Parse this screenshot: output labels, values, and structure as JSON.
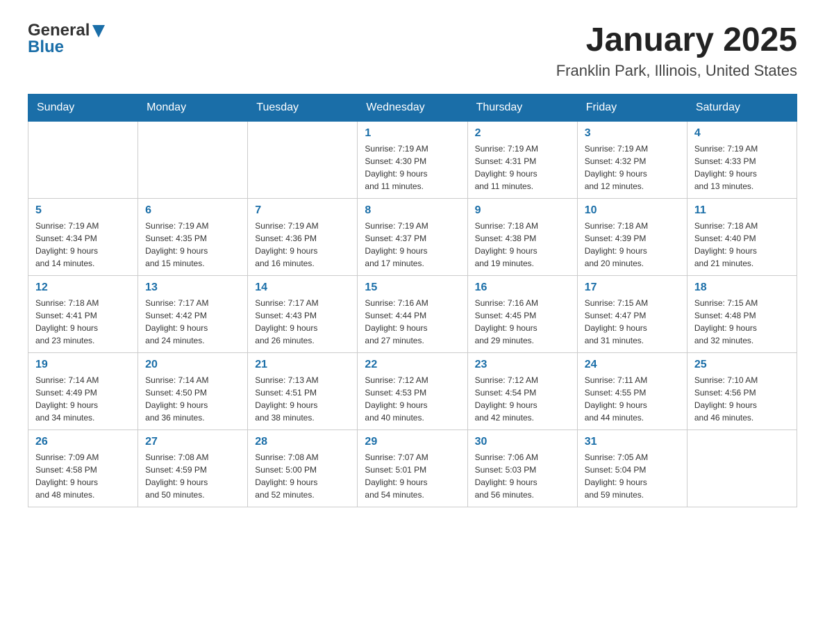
{
  "logo": {
    "line1": "General",
    "line2": "Blue"
  },
  "title": "January 2025",
  "subtitle": "Franklin Park, Illinois, United States",
  "weekdays": [
    "Sunday",
    "Monday",
    "Tuesday",
    "Wednesday",
    "Thursday",
    "Friday",
    "Saturday"
  ],
  "weeks": [
    [
      {
        "day": "",
        "info": ""
      },
      {
        "day": "",
        "info": ""
      },
      {
        "day": "",
        "info": ""
      },
      {
        "day": "1",
        "info": "Sunrise: 7:19 AM\nSunset: 4:30 PM\nDaylight: 9 hours\nand 11 minutes."
      },
      {
        "day": "2",
        "info": "Sunrise: 7:19 AM\nSunset: 4:31 PM\nDaylight: 9 hours\nand 11 minutes."
      },
      {
        "day": "3",
        "info": "Sunrise: 7:19 AM\nSunset: 4:32 PM\nDaylight: 9 hours\nand 12 minutes."
      },
      {
        "day": "4",
        "info": "Sunrise: 7:19 AM\nSunset: 4:33 PM\nDaylight: 9 hours\nand 13 minutes."
      }
    ],
    [
      {
        "day": "5",
        "info": "Sunrise: 7:19 AM\nSunset: 4:34 PM\nDaylight: 9 hours\nand 14 minutes."
      },
      {
        "day": "6",
        "info": "Sunrise: 7:19 AM\nSunset: 4:35 PM\nDaylight: 9 hours\nand 15 minutes."
      },
      {
        "day": "7",
        "info": "Sunrise: 7:19 AM\nSunset: 4:36 PM\nDaylight: 9 hours\nand 16 minutes."
      },
      {
        "day": "8",
        "info": "Sunrise: 7:19 AM\nSunset: 4:37 PM\nDaylight: 9 hours\nand 17 minutes."
      },
      {
        "day": "9",
        "info": "Sunrise: 7:18 AM\nSunset: 4:38 PM\nDaylight: 9 hours\nand 19 minutes."
      },
      {
        "day": "10",
        "info": "Sunrise: 7:18 AM\nSunset: 4:39 PM\nDaylight: 9 hours\nand 20 minutes."
      },
      {
        "day": "11",
        "info": "Sunrise: 7:18 AM\nSunset: 4:40 PM\nDaylight: 9 hours\nand 21 minutes."
      }
    ],
    [
      {
        "day": "12",
        "info": "Sunrise: 7:18 AM\nSunset: 4:41 PM\nDaylight: 9 hours\nand 23 minutes."
      },
      {
        "day": "13",
        "info": "Sunrise: 7:17 AM\nSunset: 4:42 PM\nDaylight: 9 hours\nand 24 minutes."
      },
      {
        "day": "14",
        "info": "Sunrise: 7:17 AM\nSunset: 4:43 PM\nDaylight: 9 hours\nand 26 minutes."
      },
      {
        "day": "15",
        "info": "Sunrise: 7:16 AM\nSunset: 4:44 PM\nDaylight: 9 hours\nand 27 minutes."
      },
      {
        "day": "16",
        "info": "Sunrise: 7:16 AM\nSunset: 4:45 PM\nDaylight: 9 hours\nand 29 minutes."
      },
      {
        "day": "17",
        "info": "Sunrise: 7:15 AM\nSunset: 4:47 PM\nDaylight: 9 hours\nand 31 minutes."
      },
      {
        "day": "18",
        "info": "Sunrise: 7:15 AM\nSunset: 4:48 PM\nDaylight: 9 hours\nand 32 minutes."
      }
    ],
    [
      {
        "day": "19",
        "info": "Sunrise: 7:14 AM\nSunset: 4:49 PM\nDaylight: 9 hours\nand 34 minutes."
      },
      {
        "day": "20",
        "info": "Sunrise: 7:14 AM\nSunset: 4:50 PM\nDaylight: 9 hours\nand 36 minutes."
      },
      {
        "day": "21",
        "info": "Sunrise: 7:13 AM\nSunset: 4:51 PM\nDaylight: 9 hours\nand 38 minutes."
      },
      {
        "day": "22",
        "info": "Sunrise: 7:12 AM\nSunset: 4:53 PM\nDaylight: 9 hours\nand 40 minutes."
      },
      {
        "day": "23",
        "info": "Sunrise: 7:12 AM\nSunset: 4:54 PM\nDaylight: 9 hours\nand 42 minutes."
      },
      {
        "day": "24",
        "info": "Sunrise: 7:11 AM\nSunset: 4:55 PM\nDaylight: 9 hours\nand 44 minutes."
      },
      {
        "day": "25",
        "info": "Sunrise: 7:10 AM\nSunset: 4:56 PM\nDaylight: 9 hours\nand 46 minutes."
      }
    ],
    [
      {
        "day": "26",
        "info": "Sunrise: 7:09 AM\nSunset: 4:58 PM\nDaylight: 9 hours\nand 48 minutes."
      },
      {
        "day": "27",
        "info": "Sunrise: 7:08 AM\nSunset: 4:59 PM\nDaylight: 9 hours\nand 50 minutes."
      },
      {
        "day": "28",
        "info": "Sunrise: 7:08 AM\nSunset: 5:00 PM\nDaylight: 9 hours\nand 52 minutes."
      },
      {
        "day": "29",
        "info": "Sunrise: 7:07 AM\nSunset: 5:01 PM\nDaylight: 9 hours\nand 54 minutes."
      },
      {
        "day": "30",
        "info": "Sunrise: 7:06 AM\nSunset: 5:03 PM\nDaylight: 9 hours\nand 56 minutes."
      },
      {
        "day": "31",
        "info": "Sunrise: 7:05 AM\nSunset: 5:04 PM\nDaylight: 9 hours\nand 59 minutes."
      },
      {
        "day": "",
        "info": ""
      }
    ]
  ]
}
